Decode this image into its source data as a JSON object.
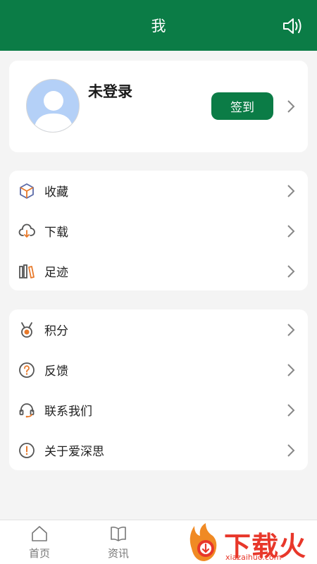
{
  "header": {
    "title": "我",
    "speaker_icon": "speaker-icon"
  },
  "profile": {
    "username": "未登录",
    "signin_label": "签到",
    "avatar_icon": "default-avatar-icon"
  },
  "menu_group_1": [
    {
      "label": "收藏",
      "icon": "cube-icon"
    },
    {
      "label": "下载",
      "icon": "cloud-download-icon"
    },
    {
      "label": "足迹",
      "icon": "books-icon"
    }
  ],
  "menu_group_2": [
    {
      "label": "积分",
      "icon": "medal-icon"
    },
    {
      "label": "反馈",
      "icon": "question-icon"
    },
    {
      "label": "联系我们",
      "icon": "headset-icon"
    },
    {
      "label": "关于爱深思",
      "icon": "info-icon"
    }
  ],
  "tabbar": {
    "home_label": "首页",
    "news_label": "资讯"
  },
  "watermark": {
    "text": "下载火",
    "sub": "xiazaihuo.com"
  },
  "colors": {
    "brand_green": "#0b7c46",
    "icon_orange": "#e8792a",
    "icon_gray": "#555555"
  }
}
